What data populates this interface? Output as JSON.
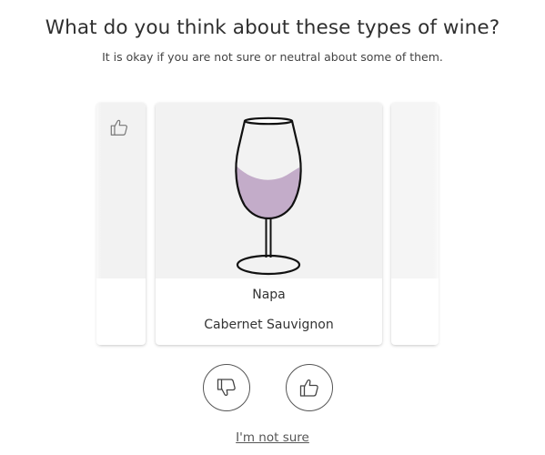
{
  "header": {
    "title": "What do you think about these types of wine?",
    "subtitle": "It is okay if you are not sure or neutral about some of them."
  },
  "carousel": {
    "previous_card": {
      "icon": "thumbs-up-icon"
    },
    "current_card": {
      "region": "Napa",
      "varietal": "Cabernet Sauvignon",
      "image": "wine-glass-icon",
      "wine_color": "#c3acc9"
    },
    "next_card": {}
  },
  "actions": {
    "dislike_icon": "thumbs-down-icon",
    "like_icon": "thumbs-up-icon",
    "not_sure_label": "I'm not sure"
  }
}
